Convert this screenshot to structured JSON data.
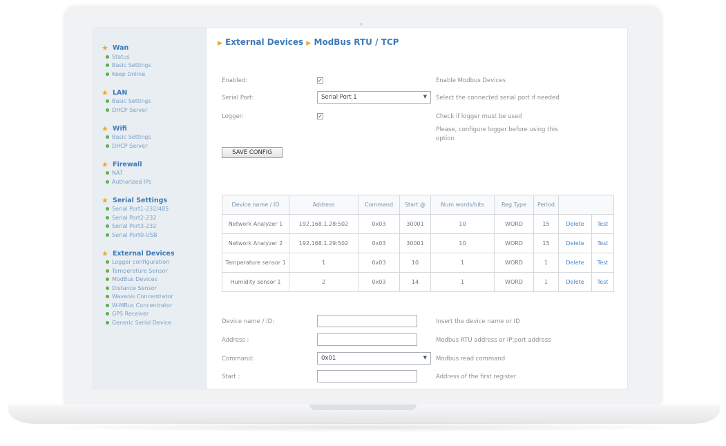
{
  "sidebar": {
    "groups": [
      {
        "title": "Wan",
        "items": [
          "Status",
          "Basic Settings",
          "Keep Online"
        ]
      },
      {
        "title": "LAN",
        "items": [
          "Basic Settings",
          "DHCP Server"
        ]
      },
      {
        "title": "Wifi",
        "items": [
          "Basic Settings",
          "DHCP Server"
        ]
      },
      {
        "title": "Firewall",
        "items": [
          "NAT",
          "Authorized IPs"
        ]
      },
      {
        "title": "Serial Settings",
        "items": [
          "Serial Port1-232/485",
          "Serial Port2-232",
          "Serial Port3-232",
          "Serial Port0-USB"
        ]
      },
      {
        "title": "External Devices",
        "items": [
          "Logger configuration",
          "Temperature Sensor",
          "ModBus Devices",
          "Distance Sensor",
          "Wavenis Concentrator",
          "W-MBus Concentrator",
          "GPS Receiver",
          "Generic Serial Device"
        ]
      }
    ]
  },
  "header": {
    "crumb1": "External Devices",
    "crumb2": "ModBus RTU / TCP"
  },
  "config": {
    "enabled_label": "Enabled:",
    "enabled_desc": "Enable Modbus Devices",
    "serial_label": "Serial Port:",
    "serial_value": "Serial Port 1",
    "serial_desc": "Select the connected serial port if needed",
    "logger_label": "Logger:",
    "logger_desc": "Check if logger must be used",
    "logger_note1": "Please, configure logger before using this",
    "logger_note2": "option",
    "save_label": "SAVE CONFIG"
  },
  "table": {
    "headers": [
      "Device name / ID",
      "Address",
      "Command",
      "Start @",
      "Num words/bits",
      "Reg Type",
      "Period"
    ],
    "rows": [
      {
        "name": "Network Analyzer 1",
        "address": "192.168.1.28:502",
        "command": "0x03",
        "start": "30001",
        "num": "10",
        "type": "WORD",
        "period": "15",
        "delete": "Delete",
        "test": "Test"
      },
      {
        "name": "Network Analyzer 2",
        "address": "192.168.1.29:502",
        "command": "0x03",
        "start": "30001",
        "num": "10",
        "type": "WORD",
        "period": "15",
        "delete": "Delete",
        "test": "Test"
      },
      {
        "name": "Temperature sensor 1",
        "address": "1",
        "command": "0x03",
        "start": "10",
        "num": "1",
        "type": "WORD",
        "period": "1",
        "delete": "Delete",
        "test": "Test"
      },
      {
        "name": "Humidity sensor 1",
        "address": "2",
        "command": "0x03",
        "start": "14",
        "num": "1",
        "type": "WORD",
        "period": "1",
        "delete": "Delete",
        "test": "Test"
      }
    ]
  },
  "form": {
    "name_label": "Device name / ID:",
    "name_desc": "Insert the device name or ID",
    "address_label": "Address :",
    "address_desc": "Modbus RTU address or IP:port address",
    "command_label": "Command:",
    "command_value": "0x01",
    "command_desc": "Modbus read command",
    "start_label": "Start :",
    "start_desc": "Address of the first register"
  }
}
